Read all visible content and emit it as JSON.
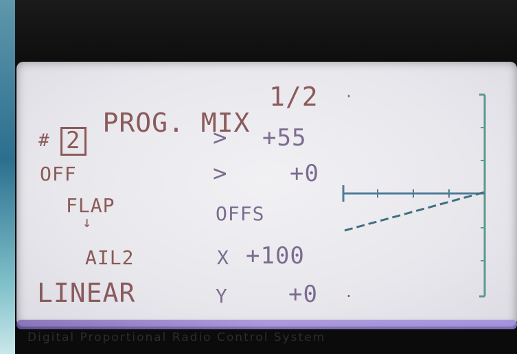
{
  "screen": {
    "title": "PROG. MIX",
    "page": "1/2",
    "mix_number": "2",
    "mix_prefix": "#",
    "status": "OFF",
    "master_channel": "FLAP",
    "arrow": "↓",
    "slave_channel": "AIL2",
    "curve_type": "LINEAR",
    "rows": {
      "rate_up": {
        "cursor": ">",
        "value": "+55"
      },
      "rate_down": {
        "cursor": ">",
        "value": "+0"
      },
      "offset": {
        "label": "OFFS"
      },
      "x": {
        "label": "X",
        "value": "+100"
      },
      "y": {
        "label": "Y",
        "value": "+0"
      }
    }
  },
  "brand_text": "Digital Proportional Radio Control System",
  "colors": {
    "lcd_text": "#8b5a58",
    "lcd_dim": "#7b6c90",
    "graph": "#5c9a8e",
    "screen_bg": "#eceaf0"
  },
  "graph": {
    "axis_x_label": "",
    "axis_y_label": "",
    "curve": "linear"
  }
}
